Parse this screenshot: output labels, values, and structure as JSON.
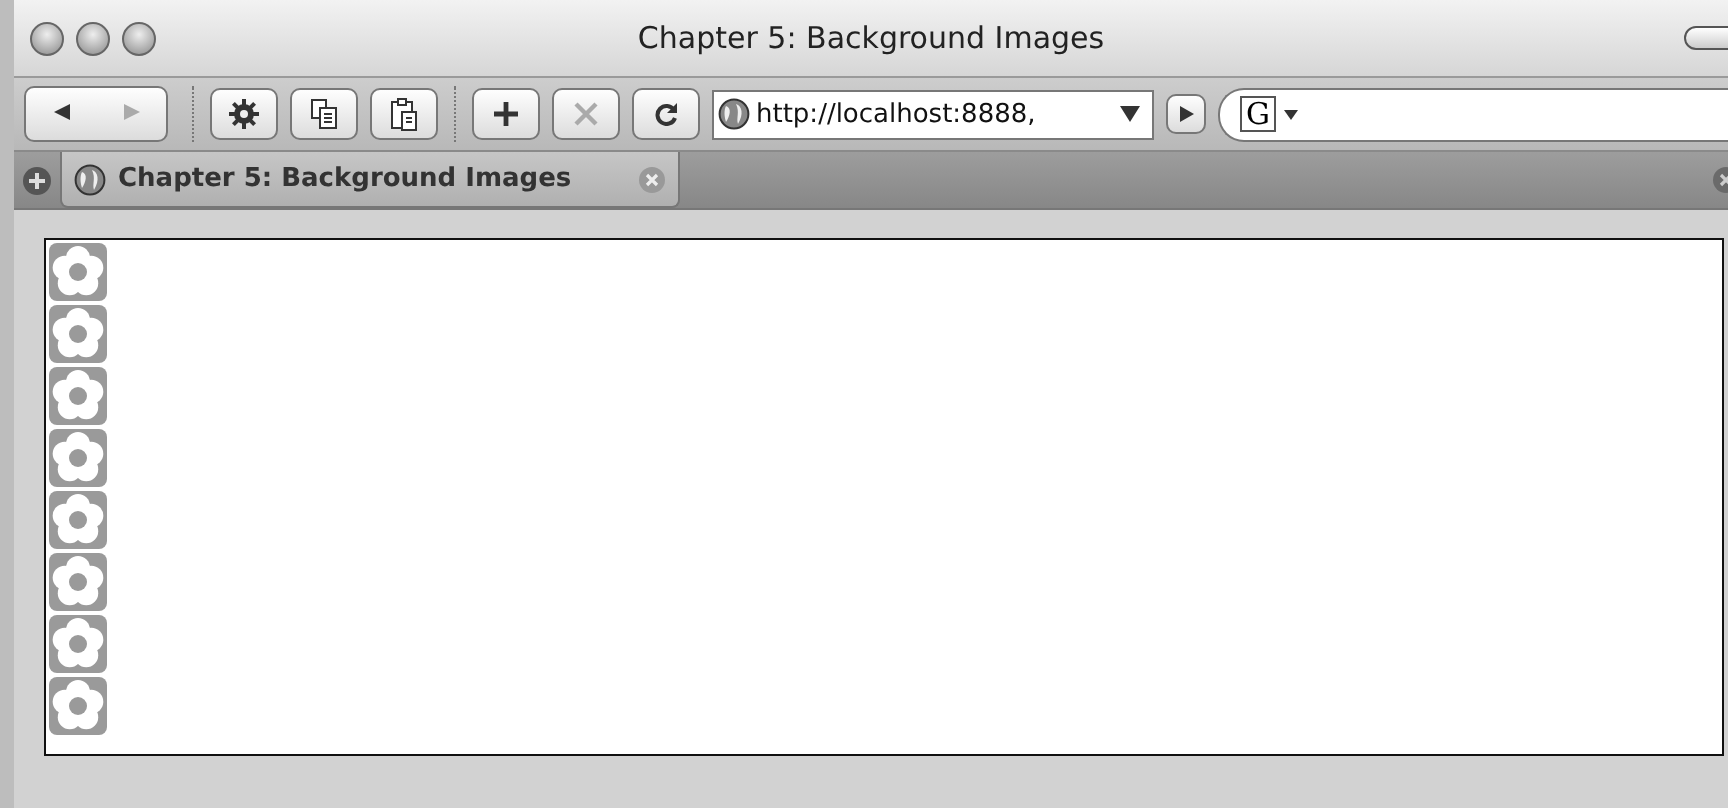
{
  "window": {
    "title": "Chapter 5: Background Images"
  },
  "toolbar": [
    {
      "kind": "back",
      "disabled": false
    },
    {
      "kind": "forward",
      "disabled": true
    },
    {
      "kind": "gear",
      "disabled": false
    },
    {
      "kind": "copy",
      "disabled": false
    },
    {
      "kind": "paste",
      "disabled": false
    },
    {
      "kind": "add",
      "disabled": false
    },
    {
      "kind": "stop",
      "disabled": true
    },
    {
      "kind": "reload",
      "disabled": false
    }
  ],
  "address": {
    "value": "http://localhost:8888,"
  },
  "search": {
    "engine": "G"
  },
  "tabs": [
    {
      "label": "Chapter 5: Background Images",
      "selected": true
    }
  ],
  "page": {
    "tiles": [
      {
        "kind": "flower"
      },
      {
        "kind": "flower"
      },
      {
        "kind": "flower"
      },
      {
        "kind": "flower"
      },
      {
        "kind": "flower"
      },
      {
        "kind": "flower"
      },
      {
        "kind": "flower"
      },
      {
        "kind": "flower"
      }
    ]
  }
}
